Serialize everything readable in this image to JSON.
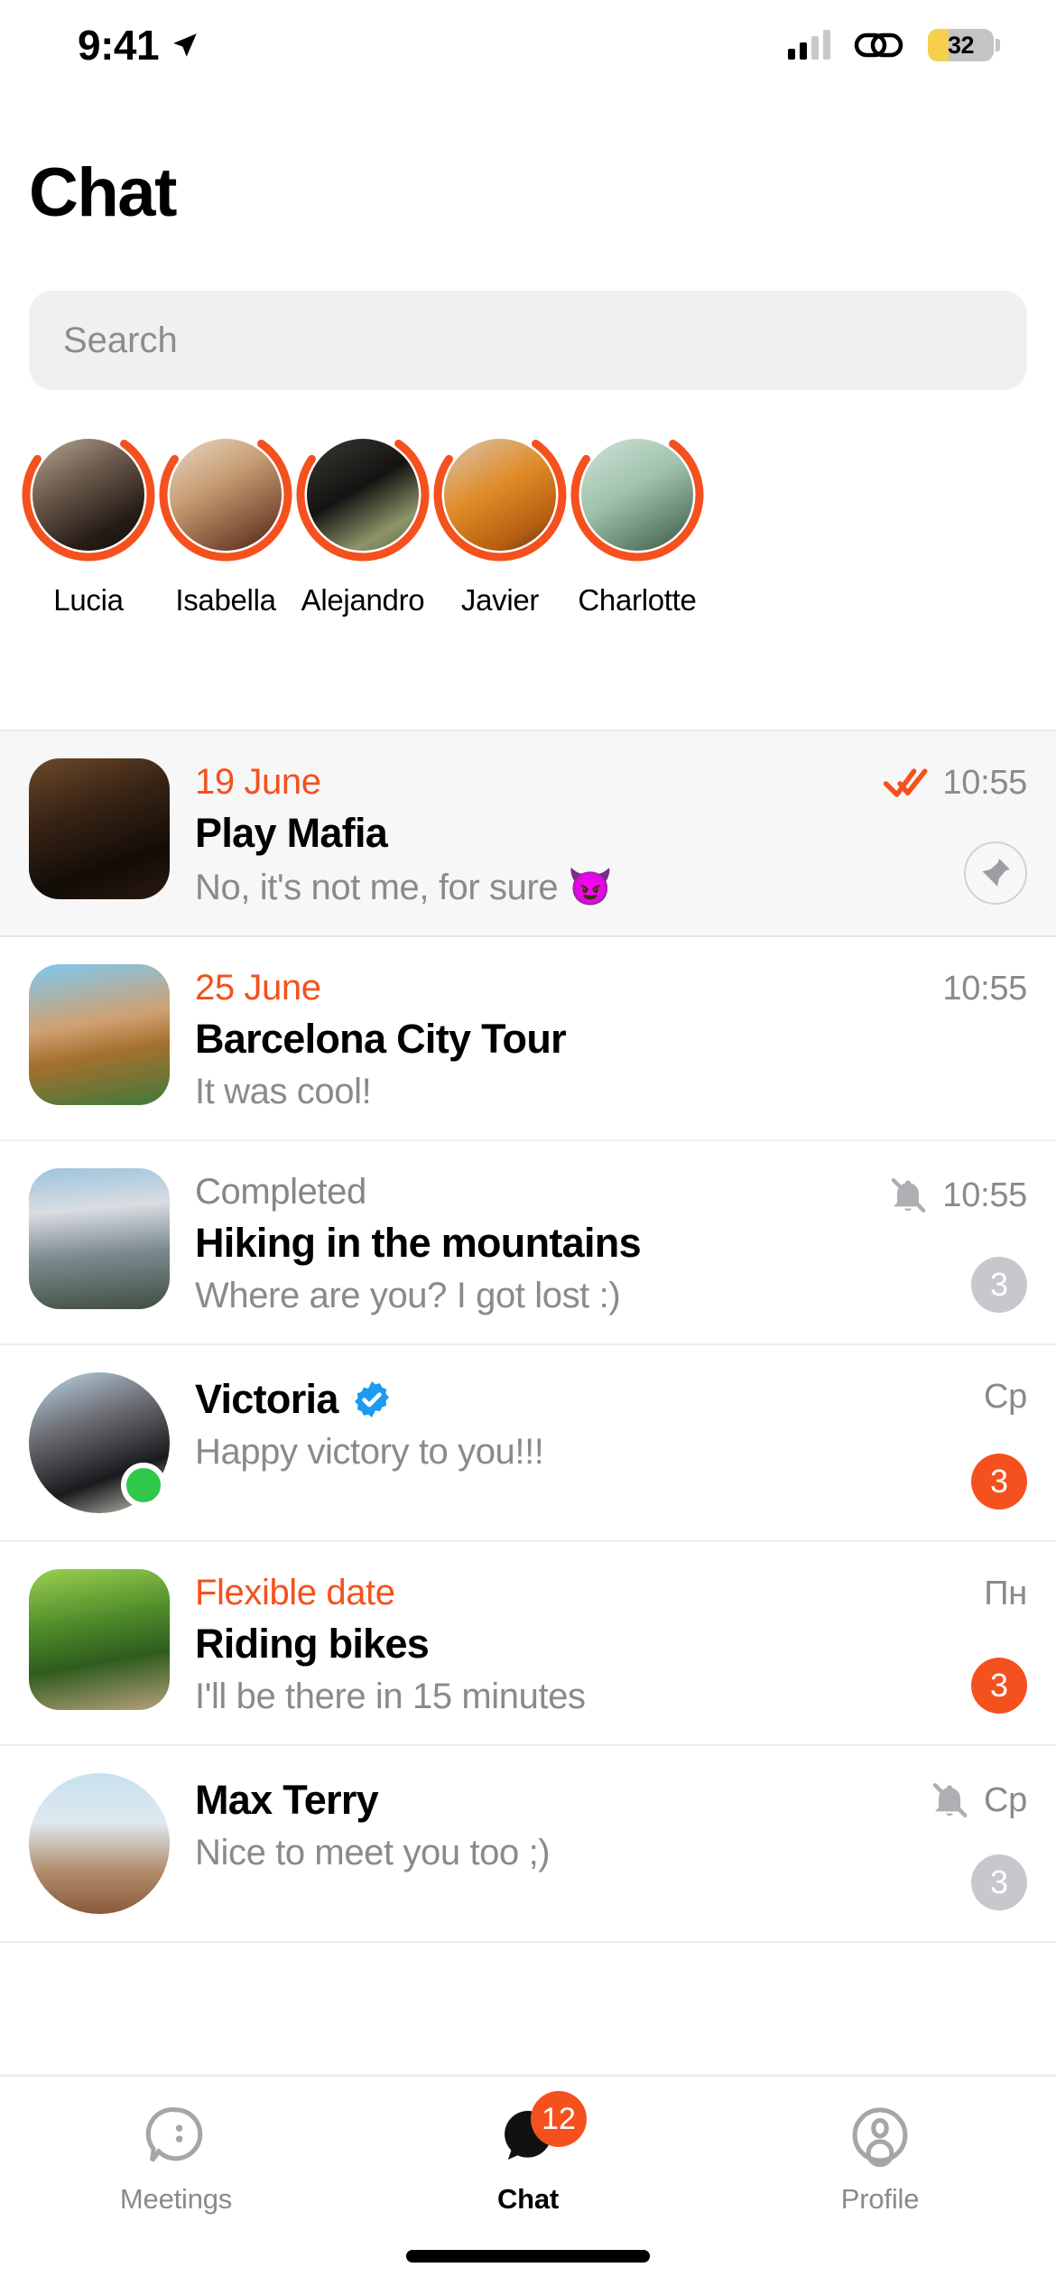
{
  "status_bar": {
    "time": "9:41",
    "location_icon": "location-arrow-icon",
    "signal_icon": "cellular-signal-icon",
    "link_icon": "link-chain-icon",
    "battery_percent": "32",
    "battery_level": 32,
    "battery_color": "#F6D04D"
  },
  "header": {
    "title": "Chat"
  },
  "search": {
    "placeholder": "Search",
    "value": ""
  },
  "stories": {
    "items": [
      {
        "name": "Lucia",
        "ring": "unseen"
      },
      {
        "name": "Isabella",
        "ring": "unseen"
      },
      {
        "name": "Alejandro",
        "ring": "unseen"
      },
      {
        "name": "Javier",
        "ring": "unseen"
      },
      {
        "name": "Charlotte",
        "ring": "unseen"
      }
    ]
  },
  "chats": [
    {
      "label": "19 June",
      "label_color": "#F4511E",
      "title": "Play Mafia",
      "preview": "No, it's not me, for sure 😈",
      "time": "10:55",
      "avatar_shape": "square",
      "pinned": true,
      "read_receipt": "double-check-icon",
      "muted": false,
      "badge": "",
      "badge_color": "",
      "pin_action": "pin-icon",
      "online": false,
      "verified": false
    },
    {
      "label": "25 June",
      "label_color": "#F4511E",
      "title": "Barcelona City Tour",
      "preview": "It was cool!",
      "time": "10:55",
      "avatar_shape": "square",
      "pinned": false,
      "read_receipt": "",
      "muted": false,
      "badge": "",
      "badge_color": "",
      "pin_action": "",
      "online": false,
      "verified": false
    },
    {
      "label": "Completed",
      "label_color": "#86868A",
      "title": "Hiking in the mountains",
      "preview": "Where are you? I got lost :)",
      "time": "10:55",
      "avatar_shape": "square",
      "pinned": false,
      "read_receipt": "",
      "muted": true,
      "badge": "3",
      "badge_color": "#C7C7CC",
      "pin_action": "",
      "online": false,
      "verified": false
    },
    {
      "label": "",
      "label_color": "",
      "title": "Victoria",
      "preview": "Happy victory to you!!!",
      "time": "Ср",
      "avatar_shape": "round",
      "pinned": false,
      "read_receipt": "",
      "muted": false,
      "badge": "3",
      "badge_color": "#F4511E",
      "pin_action": "",
      "online": true,
      "verified": true
    },
    {
      "label": "Flexible date",
      "label_color": "#F4511E",
      "title": "Riding bikes",
      "preview": "I'll be there in 15 minutes",
      "time": "Пн",
      "avatar_shape": "square",
      "pinned": false,
      "read_receipt": "",
      "muted": false,
      "badge": "3",
      "badge_color": "#F4511E",
      "pin_action": "",
      "online": false,
      "verified": false
    },
    {
      "label": "",
      "label_color": "",
      "title": "Max Terry",
      "preview": "Nice to meet you too ;)",
      "time": "Ср",
      "avatar_shape": "round",
      "pinned": false,
      "read_receipt": "",
      "muted": true,
      "badge": "3",
      "badge_color": "#C7C7CC",
      "pin_action": "",
      "online": false,
      "verified": false
    }
  ],
  "tabbar": {
    "items": [
      {
        "label": "Meetings",
        "icon": "meetings-bubble-icon",
        "active": false,
        "badge": ""
      },
      {
        "label": "Chat",
        "icon": "chat-bubble-icon",
        "active": true,
        "badge": "12"
      },
      {
        "label": "Profile",
        "icon": "profile-person-icon",
        "active": false,
        "badge": ""
      }
    ]
  },
  "colors": {
    "accent": "#F4511E",
    "verified_blue": "#1D9BF0",
    "online_green": "#2FC84A",
    "muted_grey": "#C7C7CC",
    "text_secondary": "#8A8A8E"
  }
}
